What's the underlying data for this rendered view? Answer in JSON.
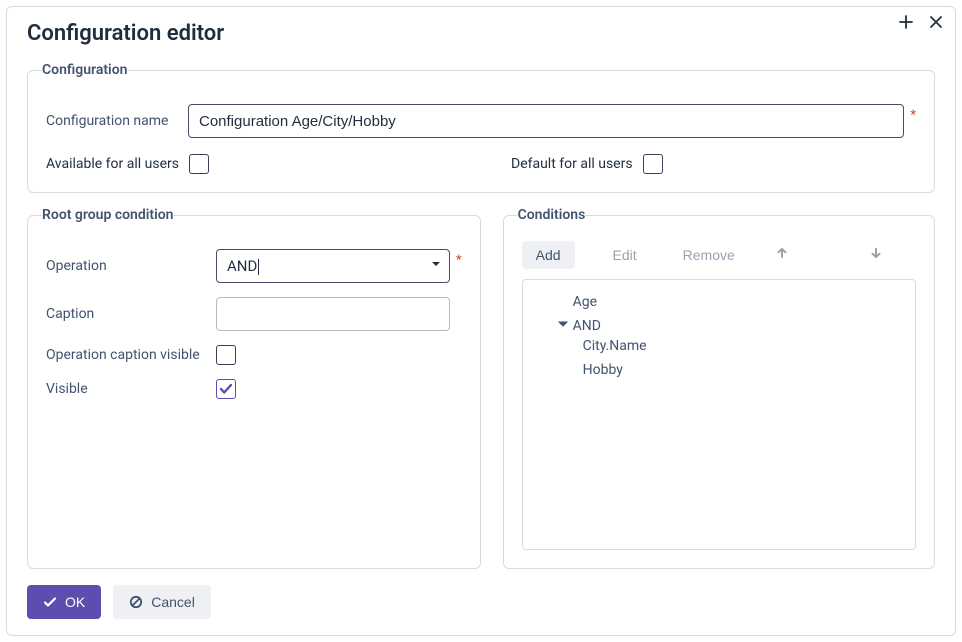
{
  "dialog": {
    "title": "Configuration editor"
  },
  "config_panel": {
    "legend": "Configuration",
    "name_label": "Configuration name",
    "name_value": "Configuration Age/City/Hobby",
    "available_label": "Available for all users",
    "available_checked": false,
    "default_label": "Default for all users",
    "default_checked": false
  },
  "root_panel": {
    "legend": "Root group condition",
    "operation_label": "Operation",
    "operation_value": "AND",
    "caption_label": "Caption",
    "caption_value": "",
    "op_caption_visible_label": "Operation caption visible",
    "op_caption_visible_checked": false,
    "visible_label": "Visible",
    "visible_checked": true
  },
  "cond_panel": {
    "legend": "Conditions",
    "toolbar": {
      "add": "Add",
      "edit": "Edit",
      "remove": "Remove"
    },
    "tree": {
      "root_items": {
        "0": "Age",
        "1": "AND"
      },
      "and_children": {
        "0": "City.Name",
        "1": "Hobby"
      }
    }
  },
  "footer": {
    "ok": "OK",
    "cancel": "Cancel"
  }
}
